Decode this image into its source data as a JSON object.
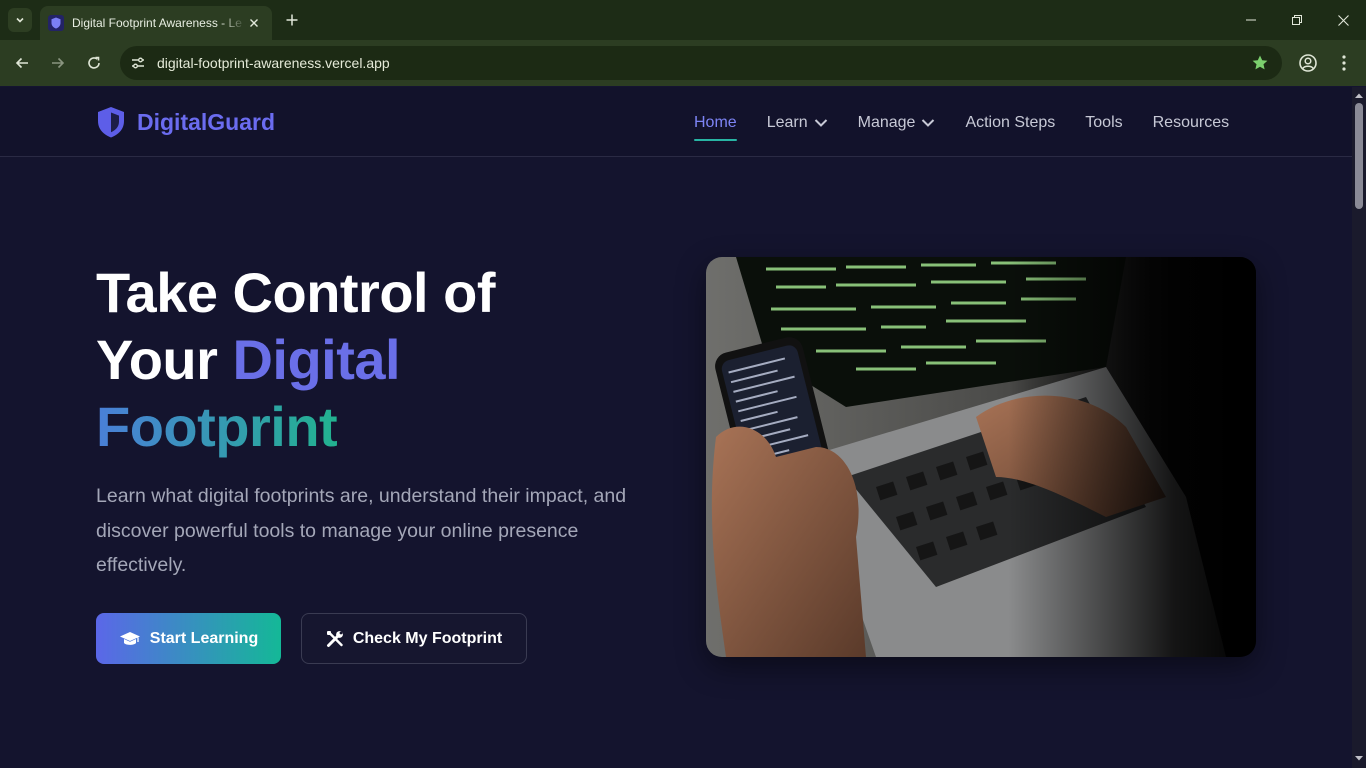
{
  "browser": {
    "tab_title": "Digital Footprint Awareness - Le",
    "url": "digital-footprint-awareness.vercel.app"
  },
  "site": {
    "brand": "DigitalGuard",
    "brand_color": "#6b6cf0",
    "nav": {
      "items": [
        {
          "label": "Home",
          "active": true,
          "dropdown": false
        },
        {
          "label": "Learn",
          "active": false,
          "dropdown": true
        },
        {
          "label": "Manage",
          "active": false,
          "dropdown": true
        },
        {
          "label": "Action Steps",
          "active": false,
          "dropdown": false
        },
        {
          "label": "Tools",
          "active": false,
          "dropdown": false
        },
        {
          "label": "Resources",
          "active": false,
          "dropdown": false
        }
      ]
    }
  },
  "hero": {
    "title_line1": "Take Control of",
    "title_line2_plain": "Your ",
    "title_line2_highlight": "Digital",
    "title_line3": "Footprint",
    "description": "Learn what digital footprints are, understand their impact, and discover powerful tools to manage your online presence effectively.",
    "primary_button": {
      "label": "Start Learning",
      "icon": "graduation-cap-icon"
    },
    "secondary_button": {
      "label": "Check My Footprint",
      "icon": "tools-icon"
    },
    "image": {
      "icon": "laptop-phone-photo"
    }
  },
  "colors": {
    "page_bg": "#14142e",
    "accent_indigo": "#6a6fe8",
    "accent_teal": "#22b28f"
  }
}
